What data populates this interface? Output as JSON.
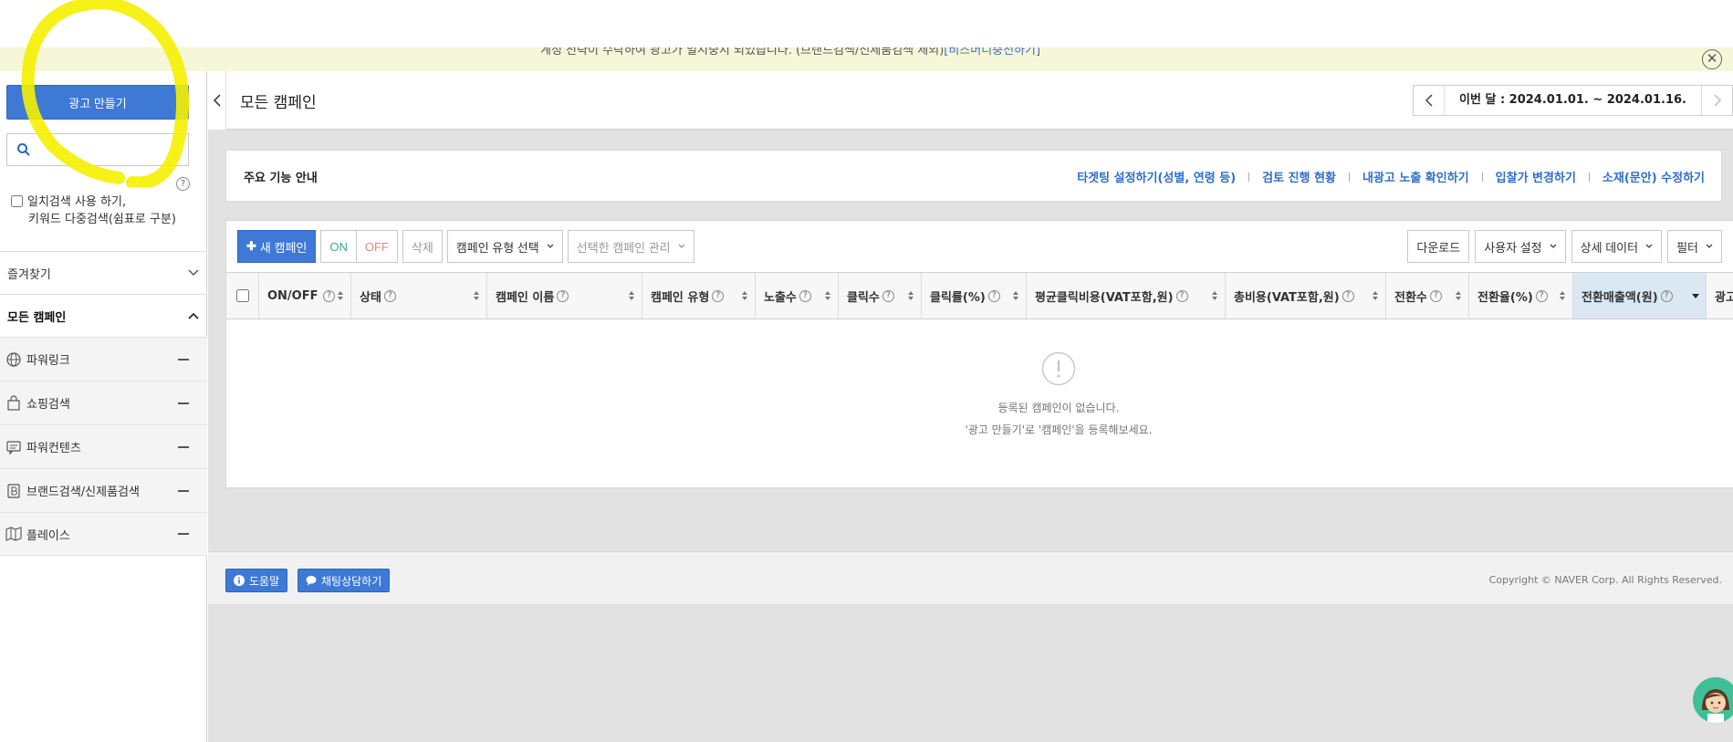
{
  "notice": {
    "text": "계정 전략이 수락하여 광고가 일시중지 되었습니다. (브랜드검색/신제품검색 제외)",
    "link": "[비즈머니충전하기]"
  },
  "sidebar": {
    "create_button": "광고 만들기",
    "search_placeholder": "",
    "help": "?",
    "exact_search_line1": "일치검색 사용 하기,",
    "exact_search_line2": "키워드 다중검색(쉼표로 구분)",
    "favorites": "즐겨찾기",
    "all_campaigns": "모든 캠페인",
    "items": [
      {
        "label": "파워링크",
        "icon": "globe-icon"
      },
      {
        "label": "쇼핑검색",
        "icon": "shopping-bag-icon"
      },
      {
        "label": "파워컨텐츠",
        "icon": "content-icon"
      },
      {
        "label": "브랜드검색/신제품검색",
        "icon": "brand-icon"
      },
      {
        "label": "플레이스",
        "icon": "place-icon"
      }
    ]
  },
  "header": {
    "title": "모든 캠페인",
    "date_range": "이번 달 : 2024.01.01. ~ 2024.01.16."
  },
  "features": {
    "title": "주요 기능 안내",
    "links": [
      "타겟팅 설정하기(성별, 연령 등)",
      "검토 진행 현황",
      "내광고 노출 확인하기",
      "입찰가 변경하기",
      "소재(문안) 수정하기"
    ]
  },
  "toolbar": {
    "new_campaign": "새 캠페인",
    "on": "ON",
    "off": "OFF",
    "delete": "삭제",
    "campaign_type_select": "캠페인 유형 선택",
    "manage_selected": "선택한 캠페인 관리",
    "download": "다운로드",
    "user_settings": "사용자 설정",
    "detail_data": "상세 데이터",
    "filter": "필터"
  },
  "table": {
    "columns": [
      {
        "label": "ON/OFF",
        "help": true,
        "sorted": false
      },
      {
        "label": "상태",
        "help": true,
        "sorted": false
      },
      {
        "label": "캠페인 이름",
        "help": true,
        "sorted": false
      },
      {
        "label": "캠페인 유형",
        "help": true,
        "sorted": false
      },
      {
        "label": "노출수",
        "help": true,
        "sorted": false
      },
      {
        "label": "클릭수",
        "help": true,
        "sorted": false
      },
      {
        "label": "클릭률(%)",
        "help": true,
        "sorted": false
      },
      {
        "label": "평균클릭비용(VAT포함,원)",
        "help": true,
        "sorted": false
      },
      {
        "label": "총비용(VAT포함,원)",
        "help": true,
        "sorted": false
      },
      {
        "label": "전환수",
        "help": true,
        "sorted": false
      },
      {
        "label": "전환율(%)",
        "help": true,
        "sorted": false
      },
      {
        "label": "전환매출액(원)",
        "help": true,
        "sorted": true
      },
      {
        "label": "광고",
        "help": false,
        "sorted": false
      }
    ],
    "empty_line1": "등록된 캠페인이 없습니다.",
    "empty_line2": "'광고 만들기'로 '캠페인'을 등록해보세요."
  },
  "footer": {
    "help_button": "도움말",
    "chat_button": "채팅상담하기",
    "copyright": "Copyright © NAVER Corp. All Rights Reserved."
  },
  "colors": {
    "accent": "#3e79d6",
    "link": "#2f6fc6",
    "highlight": "#f5f000",
    "notice_bg": "#f6f6d8"
  }
}
